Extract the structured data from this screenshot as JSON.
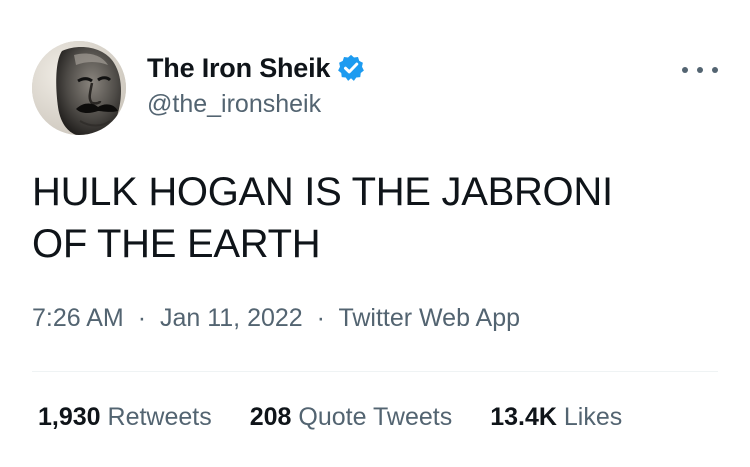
{
  "user": {
    "display_name": "The Iron Sheik",
    "handle": "@the_ironsheik",
    "verified": true
  },
  "icons": {
    "verified": "verified-badge-icon",
    "more": "more-horizontal-icon"
  },
  "tweet": {
    "text_lines": [
      "HULK HOGAN IS THE JABRONI",
      "OF THE EARTH"
    ],
    "time": "7:26 AM",
    "date": "Jan 11, 2022",
    "source": "Twitter Web App",
    "separator": "·"
  },
  "stats": {
    "retweets": {
      "count": "1,930",
      "label": "Retweets"
    },
    "quotes": {
      "count": "208",
      "label": "Quote Tweets"
    },
    "likes": {
      "count": "13.4K",
      "label": "Likes"
    }
  },
  "colors": {
    "text": "#0f1419",
    "secondary": "#536471",
    "verified": "#1d9bf0",
    "divider": "#eff3f4"
  }
}
